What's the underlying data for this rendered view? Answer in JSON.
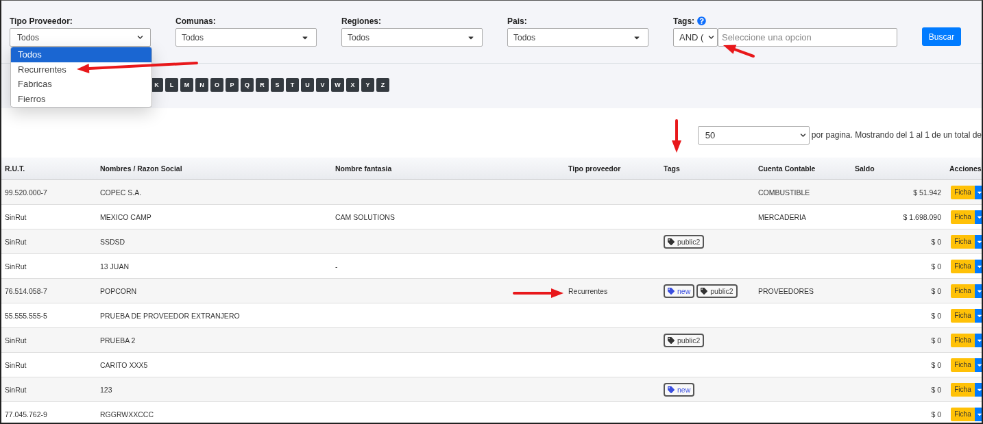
{
  "filters": [
    {
      "label": "Tipo Proveedor:",
      "value": "Todos",
      "kind": "native"
    },
    {
      "label": "Comunas:",
      "value": "Todos",
      "kind": "select2"
    },
    {
      "label": "Regiones:",
      "value": "Todos",
      "kind": "select2"
    },
    {
      "label": "Pais:",
      "value": "Todos",
      "kind": "select2"
    }
  ],
  "tags_filter": {
    "label": "Tags:",
    "operator": "AND (",
    "placeholder": "Seleccione una opcion"
  },
  "search_button": "Buscar",
  "open_dropdown": {
    "options": [
      {
        "label": "Todos",
        "selected": true
      },
      {
        "label": "Recurrentes",
        "selected": false
      },
      {
        "label": "Fabricas",
        "selected": false
      },
      {
        "label": "Fierros",
        "selected": false
      }
    ]
  },
  "letters": [
    "K",
    "L",
    "M",
    "N",
    "O",
    "P",
    "Q",
    "R",
    "S",
    "T",
    "U",
    "V",
    "W",
    "X",
    "Y",
    "Z"
  ],
  "pagination": {
    "page_size": "50",
    "summary": "por pagina. Mostrando del 1 al 1 de un total de"
  },
  "table": {
    "columns": [
      "R.U.T.",
      "Nombres / Razon Social",
      "Nombre fantasia",
      "Tipo proveedor",
      "Tags",
      "Cuenta Contable",
      "Saldo",
      "Acciones"
    ],
    "rows": [
      {
        "rut": "99.520.000-7",
        "name": "COPEC S.A.",
        "fantasy": "",
        "type": "",
        "tags": [],
        "account": "COMBUSTIBLE",
        "balance": "$ 51.942",
        "action": "Ficha"
      },
      {
        "rut": "SinRut",
        "name": "MEXICO CAMP",
        "fantasy": "CAM SOLUTIONS",
        "type": "",
        "tags": [],
        "account": "MERCADERIA",
        "balance": "$ 1.698.090",
        "action": "Ficha"
      },
      {
        "rut": "SinRut",
        "name": "SSDSD",
        "fantasy": "",
        "type": "",
        "tags": [
          {
            "label": "public2",
            "color": "#333333"
          }
        ],
        "account": "",
        "balance": "$ 0",
        "action": "Ficha"
      },
      {
        "rut": "SinRut",
        "name": "13 JUAN",
        "fantasy": "-",
        "type": "",
        "tags": [],
        "account": "",
        "balance": "$ 0",
        "action": "Ficha"
      },
      {
        "rut": "76.514.058-7",
        "name": "POPCORN",
        "fantasy": "",
        "type": "Recurrentes",
        "tags": [
          {
            "label": "new",
            "color": "#3b4fe0"
          },
          {
            "label": "public2",
            "color": "#333333"
          }
        ],
        "account": "PROVEEDORES",
        "balance": "$ 0",
        "action": "Ficha"
      },
      {
        "rut": "55.555.555-5",
        "name": "PRUEBA DE PROVEEDOR EXTRANJERO",
        "fantasy": "",
        "type": "",
        "tags": [],
        "account": "",
        "balance": "$ 0",
        "action": "Ficha"
      },
      {
        "rut": "SinRut",
        "name": "PRUEBA 2",
        "fantasy": "",
        "type": "",
        "tags": [
          {
            "label": "public2",
            "color": "#333333"
          }
        ],
        "account": "",
        "balance": "$ 0",
        "action": "Ficha"
      },
      {
        "rut": "SinRut",
        "name": "CARITO XXX5",
        "fantasy": "",
        "type": "",
        "tags": [],
        "account": "",
        "balance": "$ 0",
        "action": "Ficha"
      },
      {
        "rut": "SinRut",
        "name": "123",
        "fantasy": "",
        "type": "",
        "tags": [
          {
            "label": "new",
            "color": "#3b4fe0"
          }
        ],
        "account": "",
        "balance": "$ 0",
        "action": "Ficha"
      },
      {
        "rut": "77.045.762-9",
        "name": "RGGRWXXCCC",
        "fantasy": "",
        "type": "",
        "tags": [],
        "account": "",
        "balance": "$ 0",
        "action": "Ficha"
      }
    ]
  }
}
